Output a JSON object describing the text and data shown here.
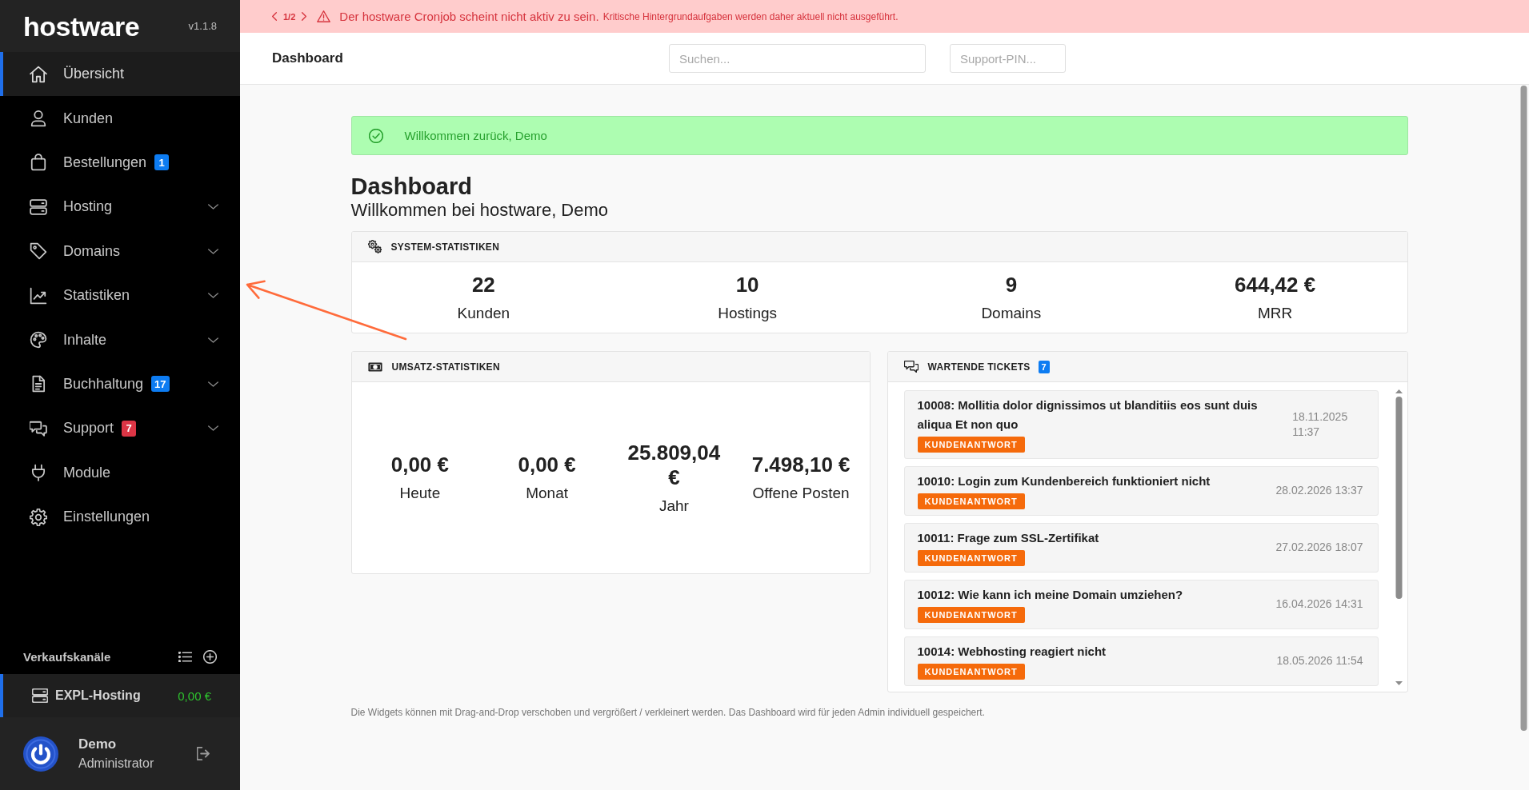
{
  "alert_banner": {
    "pager": "1/2",
    "message": "Der hostware Cronjob scheint nicht aktiv zu sein.",
    "detail": "Kritische Hintergrundaufgaben werden daher aktuell nicht ausgeführt."
  },
  "sidebar": {
    "logo": "hostware",
    "version": "v1.1.8",
    "items": [
      {
        "label": "Übersicht",
        "kind": "link",
        "selected": true
      },
      {
        "label": "Kunden",
        "kind": "link",
        "selected": false
      },
      {
        "label": "Bestellungen",
        "kind": "link",
        "selected": false,
        "badge": {
          "text": "1",
          "color": "#0d7cf2"
        }
      },
      {
        "label": "Hosting",
        "kind": "menu",
        "selected": false,
        "expanded": false
      },
      {
        "label": "Domains",
        "kind": "menu",
        "selected": false,
        "expanded": false
      },
      {
        "label": "Statistiken",
        "kind": "menu",
        "selected": false,
        "expanded": false
      },
      {
        "label": "Inhalte",
        "kind": "menu",
        "selected": false,
        "expanded": false
      },
      {
        "label": "Buchhaltung",
        "kind": "menu",
        "selected": false,
        "expanded": false,
        "badge": {
          "text": "17",
          "color": "#0d7cf2"
        }
      },
      {
        "label": "Support",
        "kind": "menu",
        "selected": false,
        "expanded": false,
        "badge": {
          "text": "7",
          "color": "#dc3545"
        }
      },
      {
        "label": "Module",
        "kind": "link",
        "selected": false
      },
      {
        "label": "Einstellungen",
        "kind": "link",
        "selected": false
      }
    ],
    "sales_channels": {
      "title": "Verkaufskanäle",
      "items": [
        {
          "name": "EXPL-Hosting",
          "amount": "0,00 €",
          "selected": true
        }
      ]
    },
    "user": {
      "name": "Demo",
      "role": "Administrator"
    }
  },
  "header": {
    "title": "Dashboard",
    "search": {
      "placeholder": "Suchen..."
    },
    "support_pin": {
      "placeholder": "Support-PIN..."
    }
  },
  "welcome_alert": {
    "message": "Willkommen zurück, Demo"
  },
  "page": {
    "title": "Dashboard",
    "subtitle": "Willkommen bei hostware, Demo"
  },
  "system_stats": {
    "title": "SYSTEM-STATISTIKEN",
    "stats": [
      {
        "value": "22",
        "label": "Kunden"
      },
      {
        "value": "10",
        "label": "Hostings"
      },
      {
        "value": "9",
        "label": "Domains"
      },
      {
        "value": "644,42 €",
        "label": "MRR"
      }
    ]
  },
  "revenue_stats": {
    "title": "UMSATZ-STATISTIKEN",
    "stats": [
      {
        "value": "0,00 €",
        "label": "Heute"
      },
      {
        "value": "0,00 €",
        "label": "Monat"
      },
      {
        "value": "25.809,04 €",
        "label": "Jahr"
      },
      {
        "value": "7.498,10 €",
        "label": "Offene Posten"
      }
    ]
  },
  "tickets": {
    "title": "WARTENDE TICKETS",
    "count": "7",
    "items": [
      {
        "title": "10008: Mollitia dolor dignissimos ut blanditiis eos sunt duis aliqua Et non quo",
        "status": "KUNDENANTWORT",
        "date": "18.11.2025 11:37"
      },
      {
        "title": "10010: Login zum Kundenbereich funktioniert nicht",
        "status": "KUNDENANTWORT",
        "date": "28.02.2026 13:37"
      },
      {
        "title": "10011: Frage zum SSL-Zertifikat",
        "status": "KUNDENANTWORT",
        "date": "27.02.2026 18:07"
      },
      {
        "title": "10012: Wie kann ich meine Domain umziehen?",
        "status": "KUNDENANTWORT",
        "date": "16.04.2026 14:31"
      },
      {
        "title": "10014: Webhosting reagiert nicht",
        "status": "KUNDENANTWORT",
        "date": "18.05.2026 11:54"
      }
    ]
  },
  "footer_note": "Die Widgets können mit Drag-and-Drop verschoben und vergrößert / verkleinert werden. Das Dashboard wird für jeden Admin individuell gespeichert."
}
